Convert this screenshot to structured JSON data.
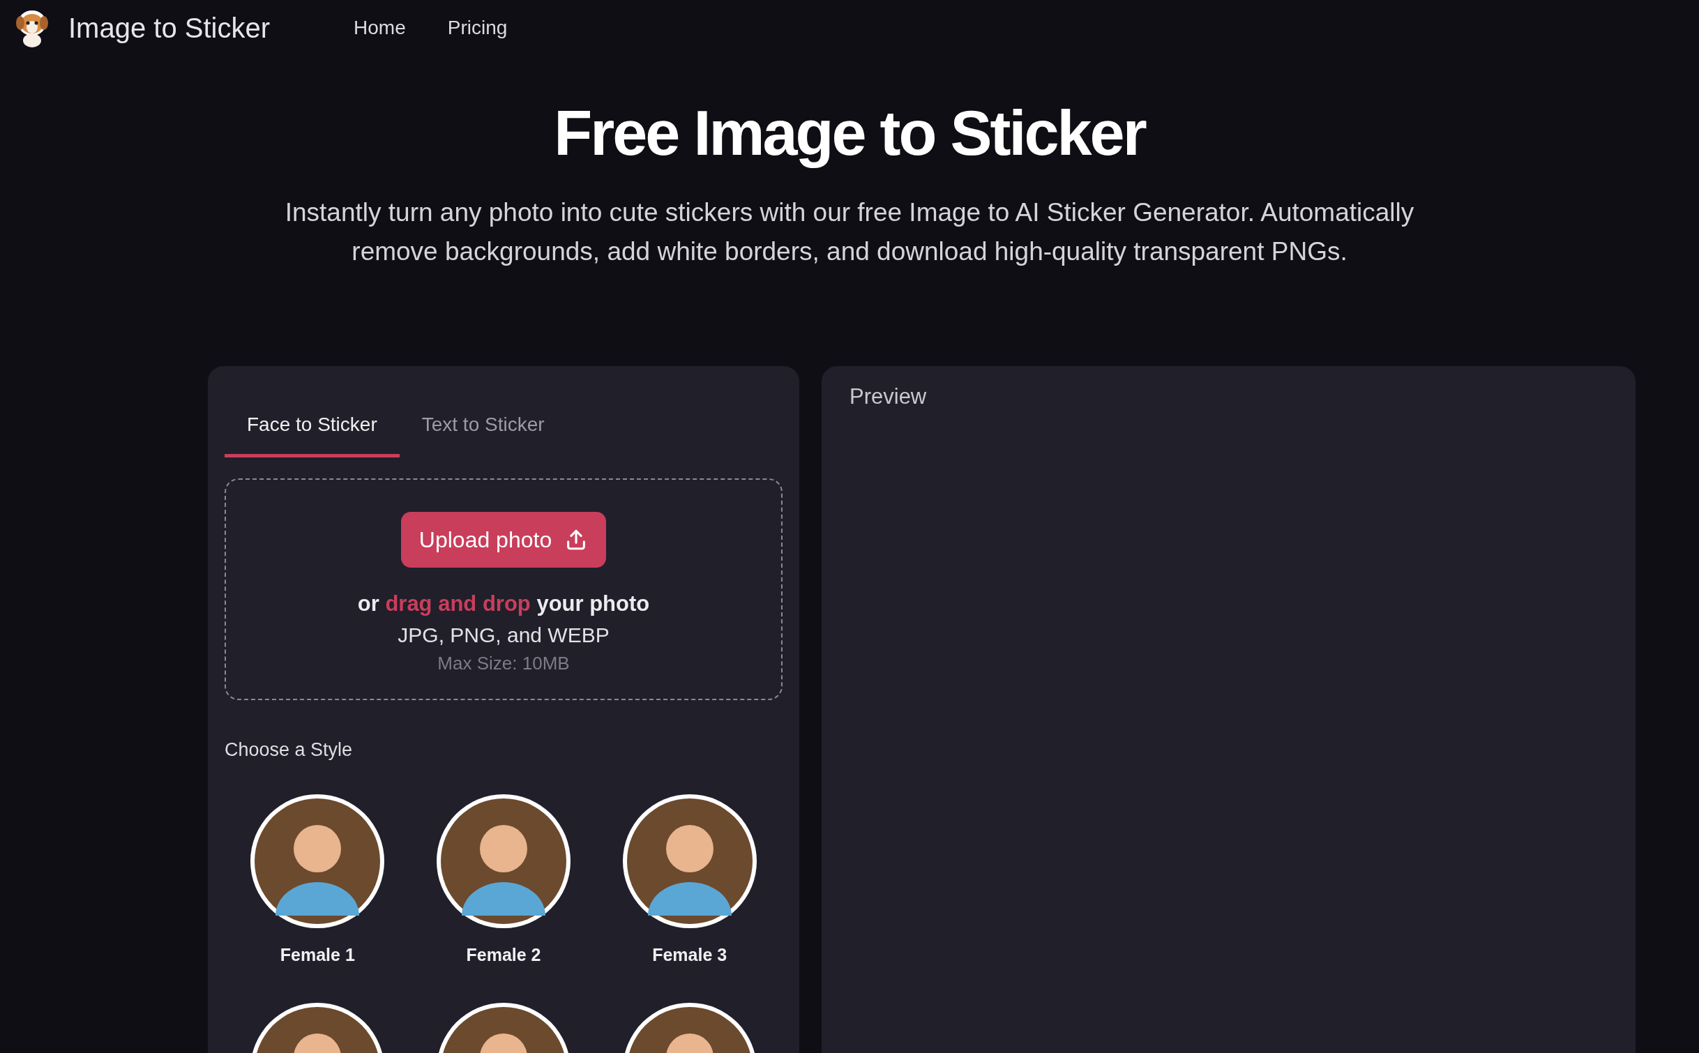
{
  "header": {
    "brand": "Image to Sticker",
    "nav": [
      {
        "label": "Home"
      },
      {
        "label": "Pricing"
      }
    ]
  },
  "hero": {
    "title": "Free Image to Sticker",
    "subtitle": "Instantly turn any photo into cute stickers with our free Image to AI Sticker Generator. Automatically remove backgrounds, add white borders, and download high-quality transparent PNGs."
  },
  "tabs": [
    {
      "label": "Face to Sticker",
      "selected": true
    },
    {
      "label": "Text to Sticker",
      "selected": false
    }
  ],
  "upload": {
    "button": "Upload photo",
    "prompt_before": "or",
    "prompt_link": "drag and drop",
    "prompt_after": "your photo",
    "formats": "JPG, PNG, and WEBP",
    "max_size": "Max Size: 10MB"
  },
  "styles": {
    "heading": "Choose a Style",
    "items": [
      {
        "kind": "portrait",
        "label": "Female 1"
      },
      {
        "kind": "portrait",
        "label": "Female 2"
      },
      {
        "kind": "portrait",
        "label": "Female 3"
      },
      {
        "kind": "portrait"
      },
      {
        "kind": "portrait"
      },
      {
        "kind": "portrait"
      }
    ]
  },
  "preview": {
    "title": "Preview"
  }
}
